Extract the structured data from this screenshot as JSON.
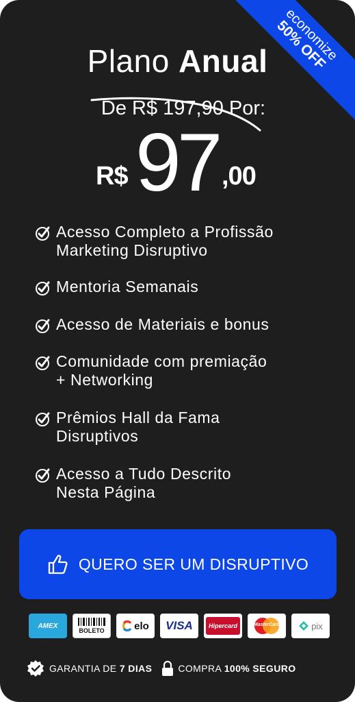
{
  "ribbon": {
    "line1": "economize",
    "line2": "50% OFF"
  },
  "plan": {
    "title_light": "Plano",
    "title_bold": "Anual"
  },
  "price": {
    "old_prefix": "De R$ ",
    "old_value": "197,90",
    "old_suffix": " Por:",
    "currency": "R$",
    "integer": "97",
    "cents": ",00"
  },
  "features": [
    "Acesso Completo a Profissão\nMarketing Disruptivo",
    "Mentoria Semanais",
    "Acesso de Materiais  e bonus",
    "Comunidade com premiação\n+ Networking",
    "Prêmios Hall da Fama\nDisruptivos",
    "Acesso a Tudo Descrito\nNesta Página"
  ],
  "cta": {
    "label": "QUERO SER UM DISRUPTIVO",
    "icon": "thumbs-up-icon"
  },
  "payments": {
    "amex": "AMEX",
    "boleto": "BOLETO",
    "elo": "elo",
    "visa": "VISA",
    "hipercard": "Hipercard",
    "mastercard": "MasterCard",
    "pix": "pix"
  },
  "guarantee": {
    "warranty_prefix": "GARANTIA DE ",
    "warranty_bold": "7 DIAS",
    "secure_prefix": "COMPRA ",
    "secure_bold": "100% SEGURO"
  },
  "colors": {
    "card_bg": "#1e1e1f",
    "accent_blue": "#0d47e8",
    "text": "#ffffff"
  }
}
